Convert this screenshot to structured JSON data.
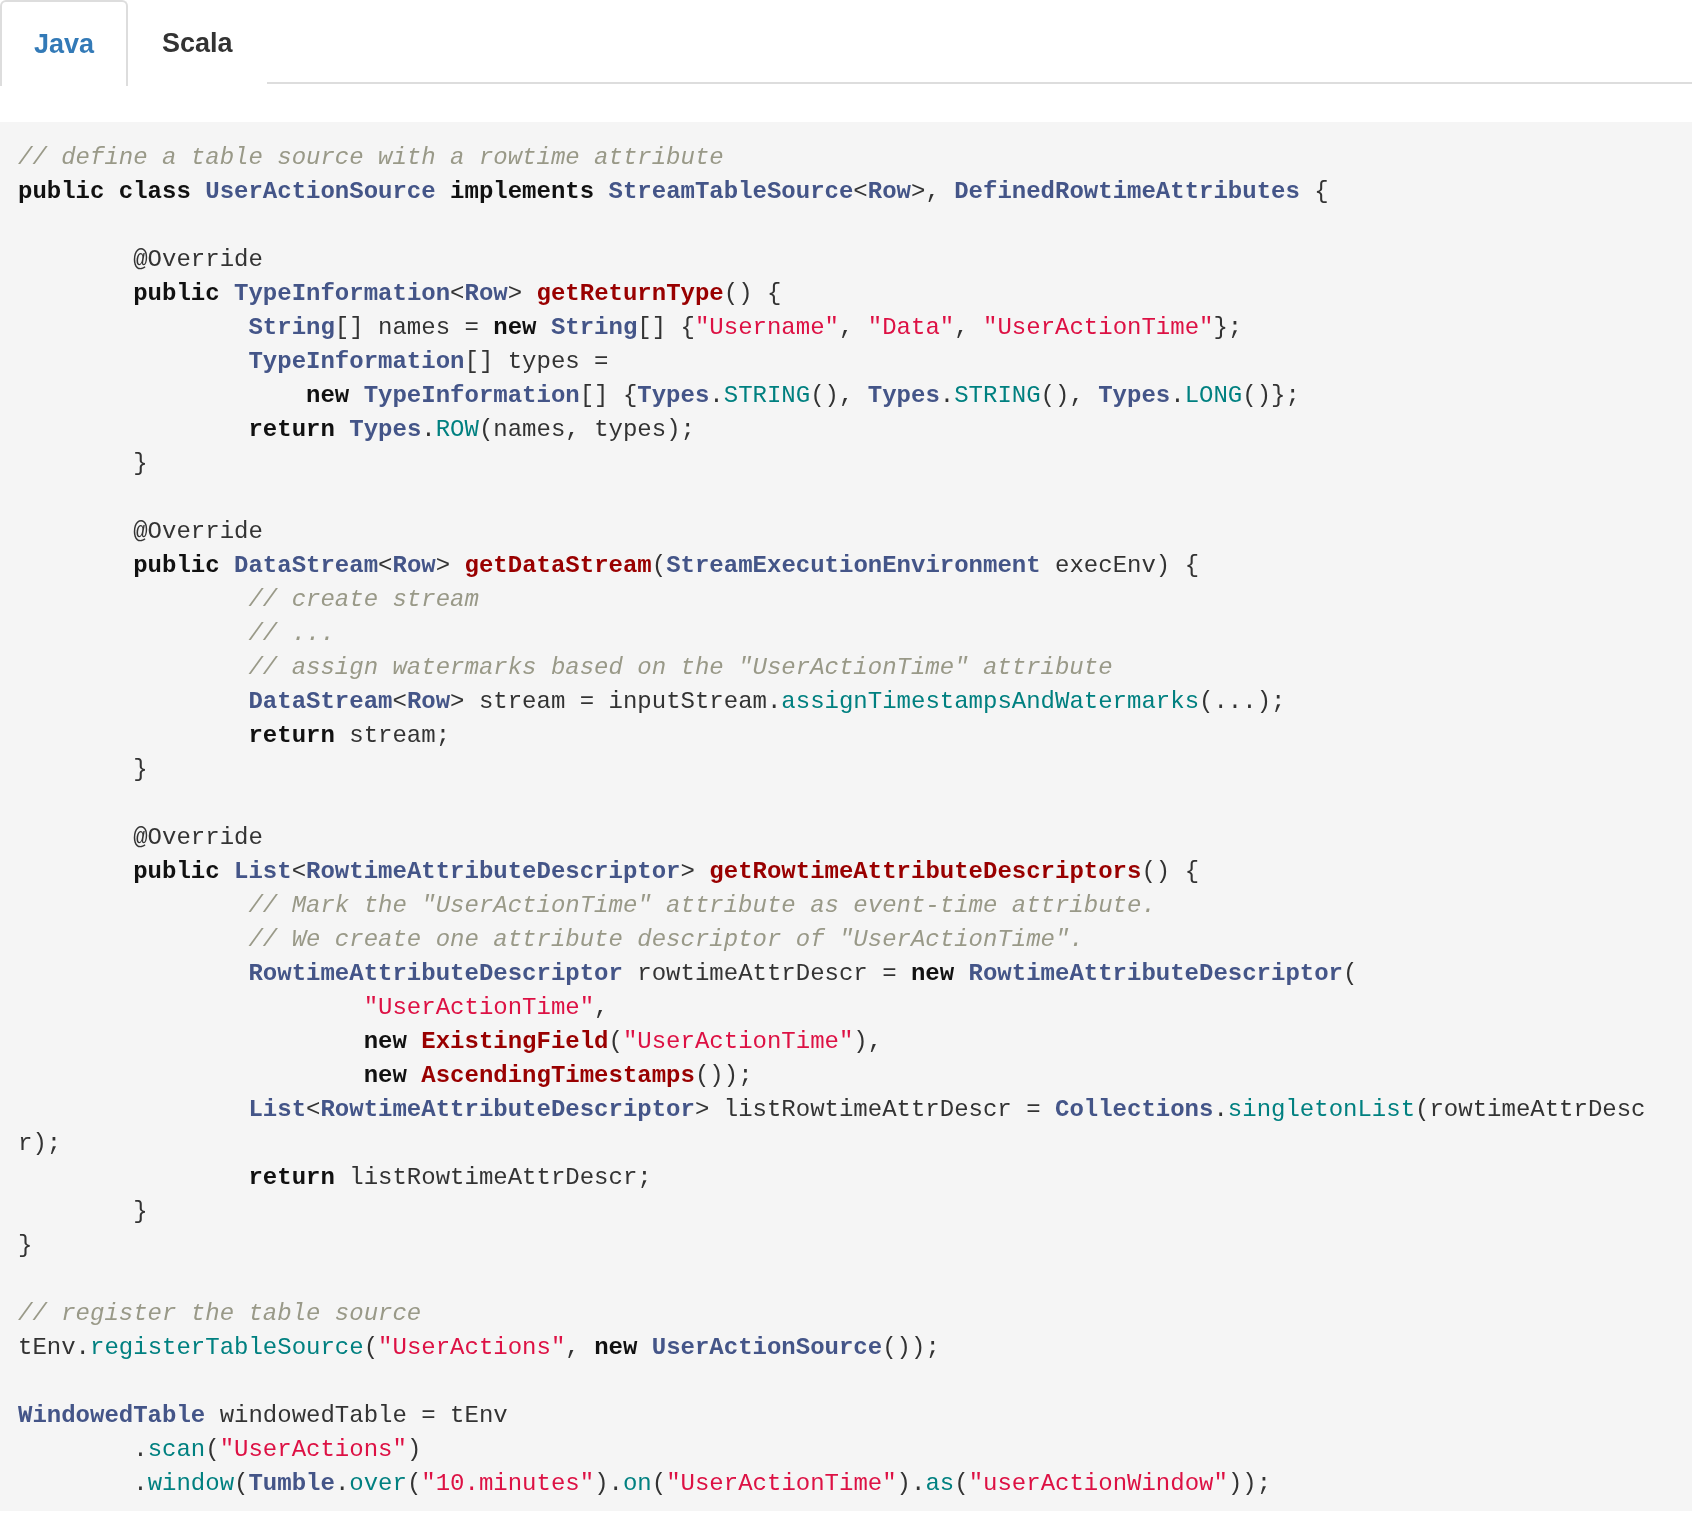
{
  "tabs": [
    {
      "label": "Java",
      "selected": true
    },
    {
      "label": "Scala",
      "selected": false
    }
  ],
  "code": {
    "lines": [
      {
        "kind": "code",
        "tokens": [
          {
            "kind": "comment",
            "text": "// define a table source with a rowtime attribute"
          }
        ]
      },
      {
        "kind": "code",
        "tokens": [
          {
            "kind": "keyword",
            "text": "public class "
          },
          {
            "kind": "type",
            "text": "UserActionSource "
          },
          {
            "kind": "keyword",
            "text": "implements "
          },
          {
            "kind": "type",
            "text": "StreamTableSource"
          },
          {
            "kind": "plain",
            "text": "<"
          },
          {
            "kind": "type",
            "text": "Row"
          },
          {
            "kind": "plain",
            "text": ">, "
          },
          {
            "kind": "type",
            "text": "DefinedRowtimeAttributes"
          },
          {
            "kind": "plain",
            "text": " {"
          }
        ]
      },
      {
        "kind": "blank"
      },
      {
        "kind": "code",
        "tokens": [
          {
            "kind": "plain",
            "text": "        @Override"
          }
        ]
      },
      {
        "kind": "code",
        "tokens": [
          {
            "kind": "keyword",
            "text": "        public "
          },
          {
            "kind": "type",
            "text": "TypeInformation"
          },
          {
            "kind": "plain",
            "text": "<"
          },
          {
            "kind": "type",
            "text": "Row"
          },
          {
            "kind": "plain",
            "text": "> "
          },
          {
            "kind": "function",
            "text": "getReturnType"
          },
          {
            "kind": "plain",
            "text": "() {"
          }
        ]
      },
      {
        "kind": "code",
        "tokens": [
          {
            "kind": "type",
            "text": "                String"
          },
          {
            "kind": "plain",
            "text": "[] names = "
          },
          {
            "kind": "keyword",
            "text": "new "
          },
          {
            "kind": "type",
            "text": "String"
          },
          {
            "kind": "plain",
            "text": "[] {"
          },
          {
            "kind": "string",
            "text": "\"Username\""
          },
          {
            "kind": "plain",
            "text": ", "
          },
          {
            "kind": "string",
            "text": "\"Data\""
          },
          {
            "kind": "plain",
            "text": ", "
          },
          {
            "kind": "string",
            "text": "\"UserActionTime\""
          },
          {
            "kind": "plain",
            "text": "};"
          }
        ]
      },
      {
        "kind": "code",
        "tokens": [
          {
            "kind": "type",
            "text": "                TypeInformation"
          },
          {
            "kind": "plain",
            "text": "[] types ="
          }
        ]
      },
      {
        "kind": "code",
        "tokens": [
          {
            "kind": "keyword",
            "text": "                    new "
          },
          {
            "kind": "type",
            "text": "TypeInformation"
          },
          {
            "kind": "plain",
            "text": "[] {"
          },
          {
            "kind": "type",
            "text": "Types"
          },
          {
            "kind": "plain",
            "text": "."
          },
          {
            "kind": "member",
            "text": "STRING"
          },
          {
            "kind": "plain",
            "text": "(), "
          },
          {
            "kind": "type",
            "text": "Types"
          },
          {
            "kind": "plain",
            "text": "."
          },
          {
            "kind": "member",
            "text": "STRING"
          },
          {
            "kind": "plain",
            "text": "(), "
          },
          {
            "kind": "type",
            "text": "Types"
          },
          {
            "kind": "plain",
            "text": "."
          },
          {
            "kind": "member",
            "text": "LONG"
          },
          {
            "kind": "plain",
            "text": "()};"
          }
        ]
      },
      {
        "kind": "code",
        "tokens": [
          {
            "kind": "keyword",
            "text": "                return "
          },
          {
            "kind": "type",
            "text": "Types"
          },
          {
            "kind": "plain",
            "text": "."
          },
          {
            "kind": "member",
            "text": "ROW"
          },
          {
            "kind": "plain",
            "text": "(names, types);"
          }
        ]
      },
      {
        "kind": "code",
        "tokens": [
          {
            "kind": "plain",
            "text": "        }"
          }
        ]
      },
      {
        "kind": "blank"
      },
      {
        "kind": "code",
        "tokens": [
          {
            "kind": "plain",
            "text": "        @Override"
          }
        ]
      },
      {
        "kind": "code",
        "tokens": [
          {
            "kind": "keyword",
            "text": "        public "
          },
          {
            "kind": "type",
            "text": "DataStream"
          },
          {
            "kind": "plain",
            "text": "<"
          },
          {
            "kind": "type",
            "text": "Row"
          },
          {
            "kind": "plain",
            "text": "> "
          },
          {
            "kind": "function",
            "text": "getDataStream"
          },
          {
            "kind": "plain",
            "text": "("
          },
          {
            "kind": "type",
            "text": "StreamExecutionEnvironment"
          },
          {
            "kind": "plain",
            "text": " execEnv) {"
          }
        ]
      },
      {
        "kind": "code",
        "tokens": [
          {
            "kind": "comment",
            "text": "                // create stream"
          }
        ]
      },
      {
        "kind": "code",
        "tokens": [
          {
            "kind": "comment",
            "text": "                // ..."
          }
        ]
      },
      {
        "kind": "code",
        "tokens": [
          {
            "kind": "comment",
            "text": "                // assign watermarks based on the \"UserActionTime\" attribute"
          }
        ]
      },
      {
        "kind": "code",
        "tokens": [
          {
            "kind": "type",
            "text": "                DataStream"
          },
          {
            "kind": "plain",
            "text": "<"
          },
          {
            "kind": "type",
            "text": "Row"
          },
          {
            "kind": "plain",
            "text": "> stream = inputStream."
          },
          {
            "kind": "member",
            "text": "assignTimestampsAndWatermarks"
          },
          {
            "kind": "plain",
            "text": "(...);"
          }
        ]
      },
      {
        "kind": "code",
        "tokens": [
          {
            "kind": "keyword",
            "text": "                return"
          },
          {
            "kind": "plain",
            "text": " stream;"
          }
        ]
      },
      {
        "kind": "code",
        "tokens": [
          {
            "kind": "plain",
            "text": "        }"
          }
        ]
      },
      {
        "kind": "blank"
      },
      {
        "kind": "code",
        "tokens": [
          {
            "kind": "plain",
            "text": "        @Override"
          }
        ]
      },
      {
        "kind": "code",
        "tokens": [
          {
            "kind": "keyword",
            "text": "        public "
          },
          {
            "kind": "type",
            "text": "List"
          },
          {
            "kind": "plain",
            "text": "<"
          },
          {
            "kind": "type",
            "text": "RowtimeAttributeDescriptor"
          },
          {
            "kind": "plain",
            "text": "> "
          },
          {
            "kind": "function",
            "text": "getRowtimeAttributeDescriptors"
          },
          {
            "kind": "plain",
            "text": "() {"
          }
        ]
      },
      {
        "kind": "code",
        "tokens": [
          {
            "kind": "comment",
            "text": "                // Mark the \"UserActionTime\" attribute as event-time attribute."
          }
        ]
      },
      {
        "kind": "code",
        "tokens": [
          {
            "kind": "comment",
            "text": "                // We create one attribute descriptor of \"UserActionTime\"."
          }
        ]
      },
      {
        "kind": "code",
        "tokens": [
          {
            "kind": "type",
            "text": "                RowtimeAttributeDescriptor"
          },
          {
            "kind": "plain",
            "text": " rowtimeAttrDescr = "
          },
          {
            "kind": "keyword",
            "text": "new "
          },
          {
            "kind": "type",
            "text": "RowtimeAttributeDescriptor"
          },
          {
            "kind": "plain",
            "text": "("
          }
        ]
      },
      {
        "kind": "code",
        "tokens": [
          {
            "kind": "string",
            "text": "                        \"UserActionTime\""
          },
          {
            "kind": "plain",
            "text": ","
          }
        ]
      },
      {
        "kind": "code",
        "tokens": [
          {
            "kind": "keyword",
            "text": "                        new "
          },
          {
            "kind": "function",
            "text": "ExistingField"
          },
          {
            "kind": "plain",
            "text": "("
          },
          {
            "kind": "string",
            "text": "\"UserActionTime\""
          },
          {
            "kind": "plain",
            "text": "),"
          }
        ]
      },
      {
        "kind": "code",
        "tokens": [
          {
            "kind": "keyword",
            "text": "                        new "
          },
          {
            "kind": "function",
            "text": "AscendingTimestamps"
          },
          {
            "kind": "plain",
            "text": "());"
          }
        ]
      },
      {
        "kind": "code",
        "tokens": [
          {
            "kind": "type",
            "text": "                List"
          },
          {
            "kind": "plain",
            "text": "<"
          },
          {
            "kind": "type",
            "text": "RowtimeAttributeDescriptor"
          },
          {
            "kind": "plain",
            "text": "> listRowtimeAttrDescr = "
          },
          {
            "kind": "type",
            "text": "Collections"
          },
          {
            "kind": "plain",
            "text": "."
          },
          {
            "kind": "member",
            "text": "singletonList"
          },
          {
            "kind": "plain",
            "text": "(rowtimeAttrDesc"
          }
        ]
      },
      {
        "kind": "code",
        "tokens": [
          {
            "kind": "plain",
            "text": "r);"
          }
        ]
      },
      {
        "kind": "code",
        "tokens": [
          {
            "kind": "keyword",
            "text": "                return"
          },
          {
            "kind": "plain",
            "text": " listRowtimeAttrDescr;"
          }
        ]
      },
      {
        "kind": "code",
        "tokens": [
          {
            "kind": "plain",
            "text": "        }"
          }
        ]
      },
      {
        "kind": "code",
        "tokens": [
          {
            "kind": "plain",
            "text": "}"
          }
        ]
      },
      {
        "kind": "blank"
      },
      {
        "kind": "code",
        "tokens": [
          {
            "kind": "comment",
            "text": "// register the table source"
          }
        ]
      },
      {
        "kind": "code",
        "tokens": [
          {
            "kind": "plain",
            "text": "tEnv."
          },
          {
            "kind": "member",
            "text": "registerTableSource"
          },
          {
            "kind": "plain",
            "text": "("
          },
          {
            "kind": "string",
            "text": "\"UserActions\""
          },
          {
            "kind": "plain",
            "text": ", "
          },
          {
            "kind": "keyword",
            "text": "new "
          },
          {
            "kind": "type",
            "text": "UserActionSource"
          },
          {
            "kind": "plain",
            "text": "());"
          }
        ]
      },
      {
        "kind": "blank"
      },
      {
        "kind": "code",
        "tokens": [
          {
            "kind": "type",
            "text": "WindowedTable"
          },
          {
            "kind": "plain",
            "text": " windowedTable = tEnv"
          }
        ]
      },
      {
        "kind": "code",
        "tokens": [
          {
            "kind": "plain",
            "text": "        ."
          },
          {
            "kind": "member",
            "text": "scan"
          },
          {
            "kind": "plain",
            "text": "("
          },
          {
            "kind": "string",
            "text": "\"UserActions\""
          },
          {
            "kind": "plain",
            "text": ")"
          }
        ]
      },
      {
        "kind": "code",
        "tokens": [
          {
            "kind": "plain",
            "text": "        ."
          },
          {
            "kind": "member",
            "text": "window"
          },
          {
            "kind": "plain",
            "text": "("
          },
          {
            "kind": "type",
            "text": "Tumble"
          },
          {
            "kind": "plain",
            "text": "."
          },
          {
            "kind": "member",
            "text": "over"
          },
          {
            "kind": "plain",
            "text": "("
          },
          {
            "kind": "string",
            "text": "\"10.minutes\""
          },
          {
            "kind": "plain",
            "text": ")."
          },
          {
            "kind": "member",
            "text": "on"
          },
          {
            "kind": "plain",
            "text": "("
          },
          {
            "kind": "string",
            "text": "\"UserActionTime\""
          },
          {
            "kind": "plain",
            "text": ")."
          },
          {
            "kind": "member",
            "text": "as"
          },
          {
            "kind": "plain",
            "text": "("
          },
          {
            "kind": "string",
            "text": "\"userActionWindow\""
          },
          {
            "kind": "plain",
            "text": "));"
          }
        ]
      }
    ]
  }
}
